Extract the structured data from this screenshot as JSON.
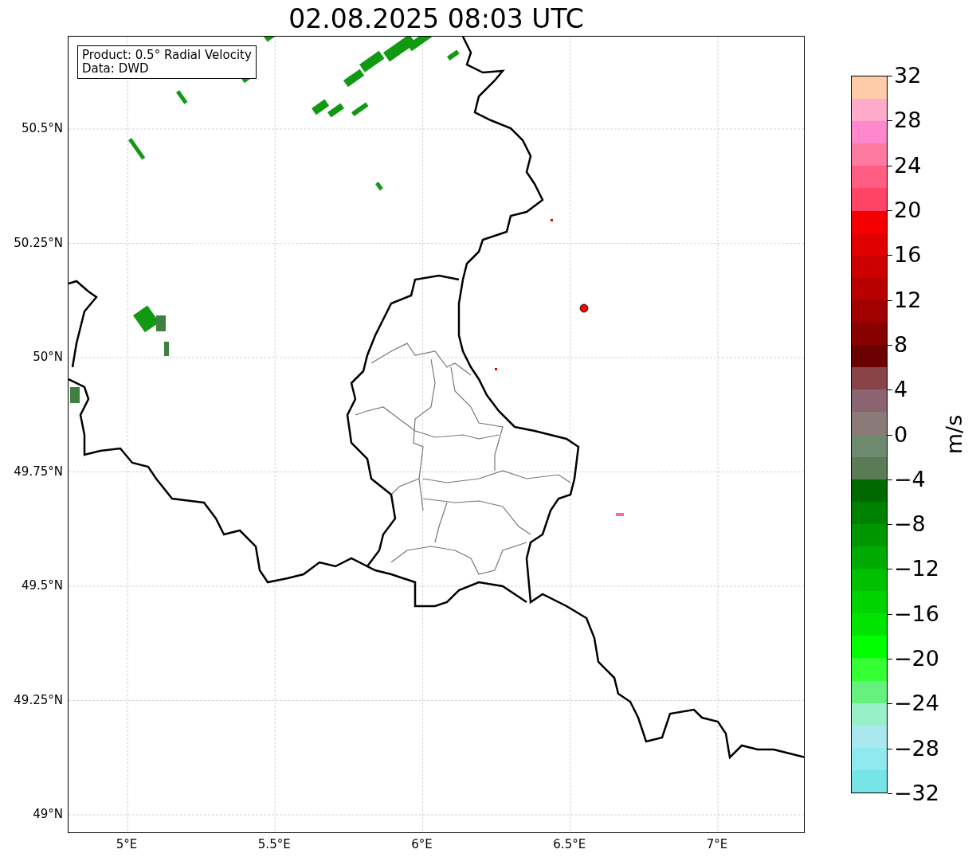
{
  "title": "02.08.2025 08:03 UTC",
  "info_box": {
    "lines": [
      "Product: 0.5° Radial Velocity",
      "Data: DWD"
    ]
  },
  "map": {
    "y_ticks": [
      "50.5°N",
      "50.25°N",
      "50°N",
      "49.75°N",
      "49.5°N",
      "49.25°N",
      "49°N"
    ],
    "x_ticks": [
      "5°E",
      "5.5°E",
      "6°E",
      "6.5°E",
      "7°E"
    ]
  },
  "colorbar": {
    "label": "m/s",
    "ticks": [
      "32",
      "28",
      "24",
      "20",
      "16",
      "12",
      "8",
      "4",
      "0",
      "−4",
      "−8",
      "−12",
      "−16",
      "−20",
      "−24",
      "−28",
      "−32"
    ],
    "segments": [
      {
        "color": "#ffccaa"
      },
      {
        "color": "#ffaac8"
      },
      {
        "color": "#ff88cc"
      },
      {
        "color": "#ff7aa0"
      },
      {
        "color": "#ff5e82"
      },
      {
        "color": "#ff4466"
      },
      {
        "color": "#f50000"
      },
      {
        "color": "#e00000"
      },
      {
        "color": "#cc0000"
      },
      {
        "color": "#b80000"
      },
      {
        "color": "#a00000"
      },
      {
        "color": "#880000"
      },
      {
        "color": "#6a0000"
      },
      {
        "color": "#884448"
      },
      {
        "color": "#8a6470"
      },
      {
        "color": "#8a7a78"
      },
      {
        "color": "#6e8a6e"
      },
      {
        "color": "#5b7b57"
      },
      {
        "color": "#006a00"
      },
      {
        "color": "#008000"
      },
      {
        "color": "#009600"
      },
      {
        "color": "#00aa00"
      },
      {
        "color": "#00c000"
      },
      {
        "color": "#00d400"
      },
      {
        "color": "#00e400"
      },
      {
        "color": "#00ff00"
      },
      {
        "color": "#33ff33"
      },
      {
        "color": "#66f07e"
      },
      {
        "color": "#98f0c8"
      },
      {
        "color": "#a8e8ee"
      },
      {
        "color": "#90e9ee"
      },
      {
        "color": "#77e5e8"
      }
    ]
  }
}
